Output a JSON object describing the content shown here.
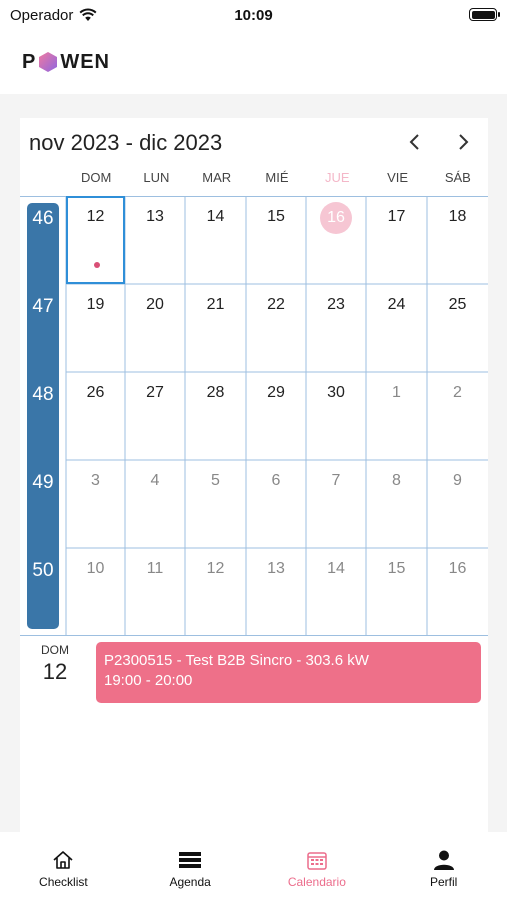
{
  "status_bar": {
    "carrier": "Operador",
    "time": "10:09"
  },
  "app": {
    "logo_text_left": "P",
    "logo_text_right": "WEN"
  },
  "calendar": {
    "title": "nov 2023 - dic 2023",
    "weekdays": [
      "DOM",
      "LUN",
      "MAR",
      "MIÉ",
      "JUE",
      "VIE",
      "SÁB"
    ],
    "today_weekday_index": 4,
    "weeks": [
      {
        "number": "46",
        "days": [
          "12",
          "13",
          "14",
          "15",
          "16",
          "17",
          "18"
        ]
      },
      {
        "number": "47",
        "days": [
          "19",
          "20",
          "21",
          "22",
          "23",
          "24",
          "25"
        ]
      },
      {
        "number": "48",
        "days": [
          "26",
          "27",
          "28",
          "29",
          "30",
          "1",
          "2"
        ]
      },
      {
        "number": "49",
        "days": [
          "3",
          "4",
          "5",
          "6",
          "7",
          "8",
          "9"
        ]
      },
      {
        "number": "50",
        "days": [
          "10",
          "11",
          "12",
          "13",
          "14",
          "15",
          "16"
        ]
      }
    ]
  },
  "agenda": {
    "day_name": "DOM",
    "day_number": "12",
    "event_title": "P2300515 - Test B2B Sincro - 303.6 kW",
    "event_time": "19:00 - 20:00"
  },
  "tabs": [
    {
      "label": "Checklist",
      "icon": "home-icon"
    },
    {
      "label": "Agenda",
      "icon": "list-icon"
    },
    {
      "label": "Calendario",
      "icon": "calendar-icon"
    },
    {
      "label": "Perfil",
      "icon": "person-icon"
    }
  ],
  "colors": {
    "accent": "#ec6d8c",
    "week_bar": "#3a76a8",
    "grid_line": "#9dbfe0",
    "selected": "#2f8fd8",
    "event": "#ee7089"
  }
}
